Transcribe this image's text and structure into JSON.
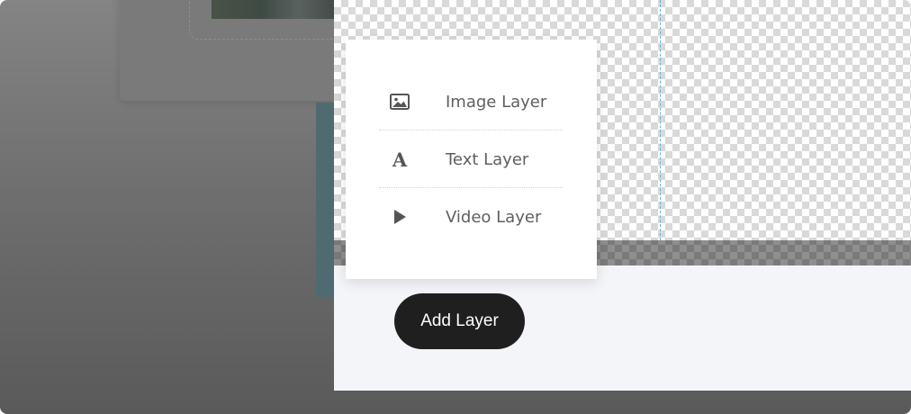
{
  "menu": {
    "items": [
      {
        "label": "Image Layer",
        "icon": "image-icon"
      },
      {
        "label": "Text Layer",
        "icon": "text-icon",
        "glyph": "A"
      },
      {
        "label": "Video Layer",
        "icon": "play-icon"
      }
    ]
  },
  "toolbar": {
    "add_layer_label": "Add Layer"
  },
  "colors": {
    "button_bg": "#1f1f1f",
    "guide_line": "#5fb4d8",
    "panel_bg": "#f4f5f9"
  }
}
